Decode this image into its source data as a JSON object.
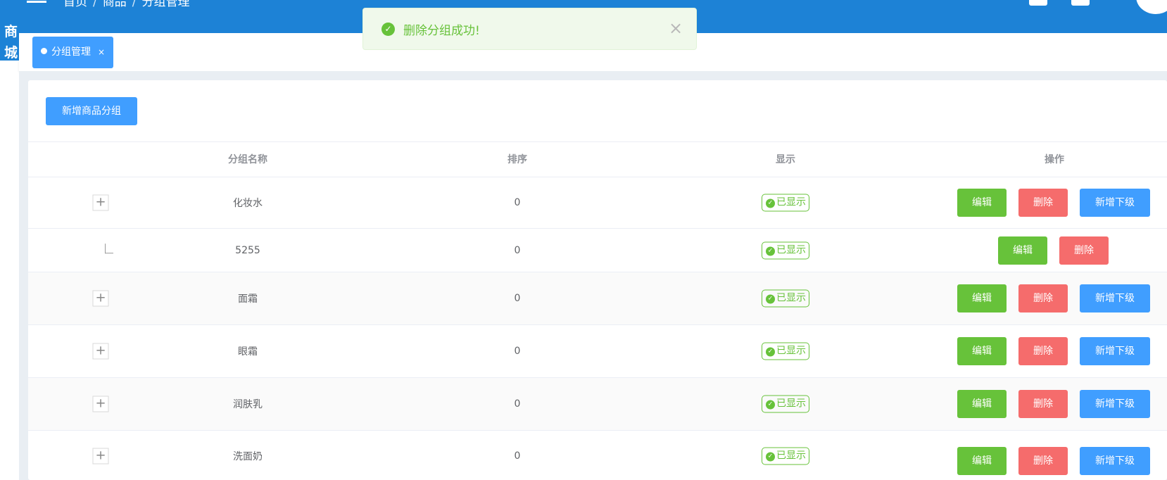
{
  "brand": {
    "text": "商城"
  },
  "breadcrumb": [
    "首页",
    "商品",
    "分组管理"
  ],
  "toast": {
    "icon": "check-circle-icon",
    "message": "删除分组成功!",
    "close": "×"
  },
  "tabs": [
    {
      "label": "分组管理",
      "close": "×"
    }
  ],
  "toolbar": {
    "add_label": "新增商品分组"
  },
  "table": {
    "columns": [
      "分组名称",
      "排序",
      "显示",
      "操作"
    ],
    "rows": [
      {
        "name": "化妆水",
        "sort": "0",
        "status": "已显示",
        "expandable": true
      },
      {
        "name": "5255",
        "sort": "0",
        "status": "已显示",
        "expandable": false,
        "child": true
      },
      {
        "name": "面霜",
        "sort": "0",
        "status": "已显示",
        "expandable": true
      },
      {
        "name": "眼霜",
        "sort": "0",
        "status": "已显示",
        "expandable": true
      },
      {
        "name": "润肤乳",
        "sort": "0",
        "status": "已显示",
        "expandable": true
      },
      {
        "name": "洗面奶",
        "sort": "0",
        "status": "已显示",
        "expandable": true
      }
    ],
    "actions": {
      "edit": "编辑",
      "delete": "删除",
      "add_child": "新增下级"
    }
  },
  "colors": {
    "header": "#1d82d6",
    "primary": "#409eff",
    "success": "#67c23a",
    "danger": "#f56c6c"
  }
}
